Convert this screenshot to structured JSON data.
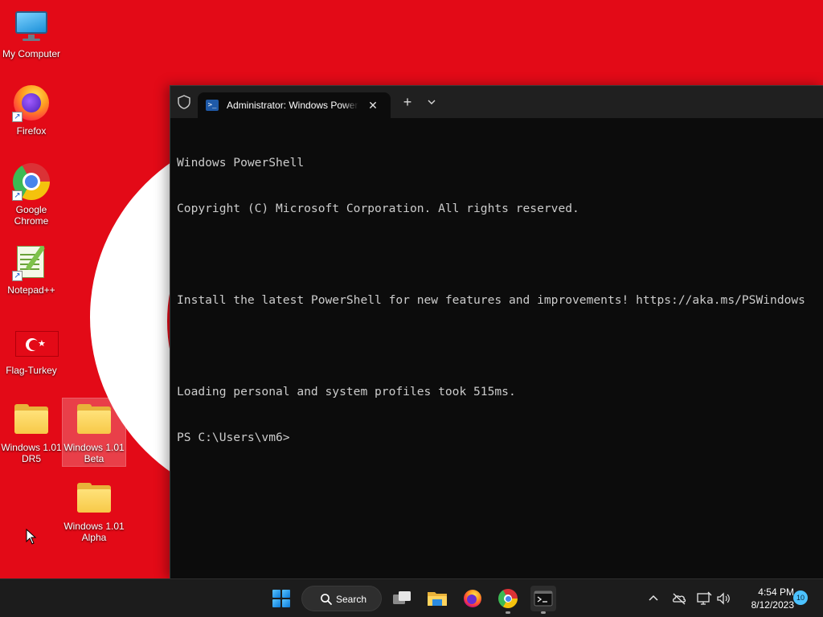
{
  "desktop": {
    "wallpaper": {
      "background_color": "#e30a17",
      "accent_color": "#ffffff"
    },
    "icons": [
      {
        "label": "My Computer",
        "icon": "monitor-icon",
        "shortcut": false
      },
      {
        "label": "Firefox",
        "icon": "firefox-icon",
        "shortcut": true
      },
      {
        "label": "Google Chrome",
        "icon": "chrome-icon",
        "shortcut": true
      },
      {
        "label": "Notepad++",
        "icon": "notepadpp-icon",
        "shortcut": true
      },
      {
        "label": "Flag-Turkey",
        "icon": "flag-icon",
        "shortcut": false
      },
      {
        "label": "Windows 1.01 DR5",
        "icon": "folder-icon",
        "shortcut": false
      },
      {
        "label": "Windows 1.01 Beta",
        "icon": "folder-icon",
        "shortcut": false,
        "selected": true
      },
      {
        "label": "Windows 1.01 Alpha",
        "icon": "folder-icon",
        "shortcut": false
      }
    ]
  },
  "terminal": {
    "tab_title": "Administrator: Windows PowerShell",
    "close_glyph": "✕",
    "new_tab_glyph": "+",
    "console_lines": [
      "Windows PowerShell",
      "Copyright (C) Microsoft Corporation. All rights reserved.",
      "",
      "Install the latest PowerShell for new features and improvements! https://aka.ms/PSWindows",
      "",
      "Loading personal and system profiles took 515ms.",
      "PS C:\\Users\\vm6>"
    ]
  },
  "taskbar": {
    "search_label": "Search",
    "apps": [
      "start-icon",
      "task-view-icon",
      "file-explorer-icon",
      "firefox-icon",
      "chrome-icon",
      "terminal-icon"
    ],
    "tray": {
      "time": "4:54 PM",
      "date": "8/12/2023",
      "notification_count": "10"
    }
  },
  "colors": {
    "terminal_background": "#0c0c0c",
    "terminal_text": "#cccccc",
    "titlebar": "#202020",
    "taskbar": "#1c1c1c",
    "notification_badge": "#4cc2ff"
  }
}
